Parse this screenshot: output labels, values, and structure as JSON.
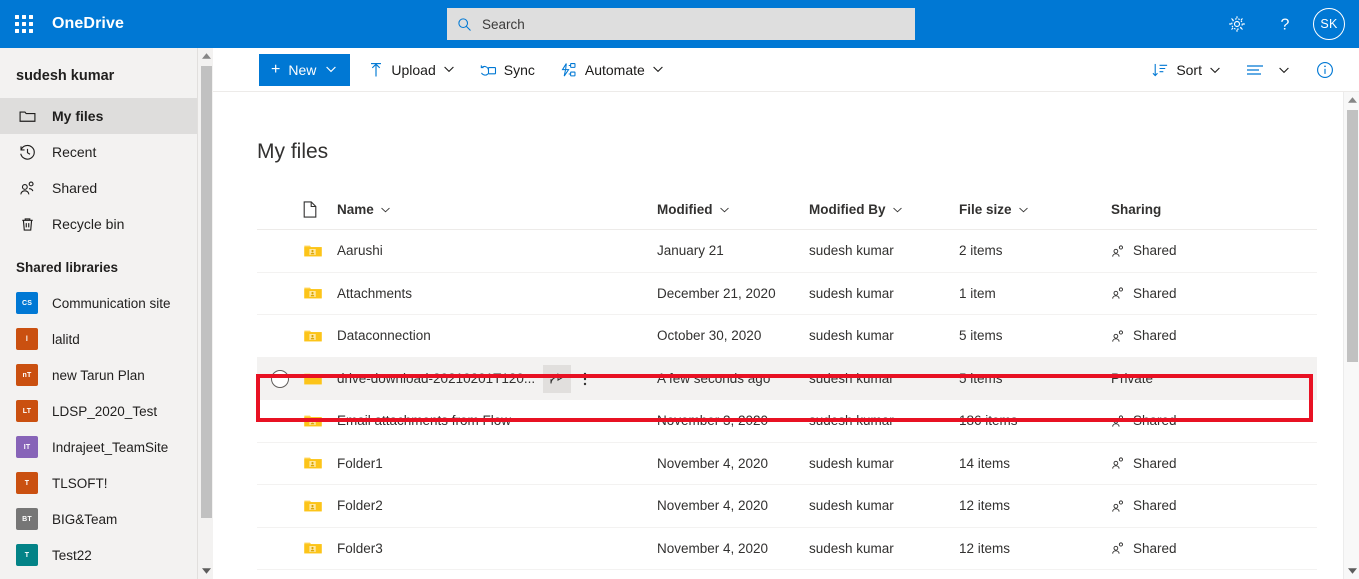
{
  "suitebar": {
    "waffle_label": "App launcher",
    "brand": "OneDrive",
    "search": {
      "placeholder": "Search",
      "value": ""
    },
    "settings_label": "Settings",
    "help_label": "Help",
    "avatar_initials": "SK",
    "bg_color": "#0078d4"
  },
  "sidebar": {
    "user": "sudesh kumar",
    "items": [
      {
        "label": "My files",
        "icon": "folder-icon",
        "selected": true
      },
      {
        "label": "Recent",
        "icon": "clock-icon",
        "selected": false
      },
      {
        "label": "Shared",
        "icon": "people-icon",
        "selected": false
      },
      {
        "label": "Recycle bin",
        "icon": "trash-icon",
        "selected": false
      }
    ],
    "section_title": "Shared libraries",
    "libraries": [
      {
        "label": "Communication site",
        "initials": "CS",
        "color": "#0078d4"
      },
      {
        "label": "lalitd",
        "initials": "l",
        "color": "#ca5010"
      },
      {
        "label": "new Tarun Plan",
        "initials": "nT",
        "color": "#ca5010"
      },
      {
        "label": "LDSP_2020_Test",
        "initials": "LT",
        "color": "#ca5010"
      },
      {
        "label": "Indrajeet_TeamSite",
        "initials": "IT",
        "color": "#8764b8"
      },
      {
        "label": "TLSOFT!",
        "initials": "T",
        "color": "#ca5010"
      },
      {
        "label": "BIG&Team",
        "initials": "BT",
        "color": "#767676"
      },
      {
        "label": "Test22",
        "initials": "T",
        "color": "#038387"
      }
    ]
  },
  "commandbar": {
    "new_label": "New",
    "upload_label": "Upload",
    "sync_label": "Sync",
    "automate_label": "Automate",
    "sort_label": "Sort",
    "view_label": "View options",
    "info_label": "Details",
    "accent_color": "#0078d4"
  },
  "content": {
    "title": "My files",
    "columns": {
      "icon": "file-type-icon",
      "name": "Name",
      "modified": "Modified",
      "modified_by": "Modified By",
      "file_size": "File size",
      "sharing": "Sharing"
    },
    "rows": [
      {
        "name": "Aarushi",
        "modified": "January 21",
        "modified_by": "sudesh kumar",
        "file_size": "2 items",
        "sharing": "Shared",
        "shared": true,
        "icon": "shared-folder-icon",
        "highlighted": false
      },
      {
        "name": "Attachments",
        "modified": "December 21, 2020",
        "modified_by": "sudesh kumar",
        "file_size": "1 item",
        "sharing": "Shared",
        "shared": true,
        "icon": "shared-folder-icon",
        "highlighted": false
      },
      {
        "name": "Dataconnection",
        "modified": "October 30, 2020",
        "modified_by": "sudesh kumar",
        "file_size": "5 items",
        "sharing": "Shared",
        "shared": true,
        "icon": "shared-folder-icon",
        "highlighted": false
      },
      {
        "name": "drive-download-20210201T120...",
        "modified": "A few seconds ago",
        "modified_by": "sudesh kumar",
        "file_size": "5 items",
        "sharing": "Private",
        "shared": false,
        "icon": "folder-icon",
        "highlighted": true
      },
      {
        "name": "Email attachments from Flow",
        "modified": "November 3, 2020",
        "modified_by": "sudesh kumar",
        "file_size": "186 items",
        "sharing": "Shared",
        "shared": true,
        "icon": "shared-folder-icon",
        "highlighted": false
      },
      {
        "name": "Folder1",
        "modified": "November 4, 2020",
        "modified_by": "sudesh kumar",
        "file_size": "14 items",
        "sharing": "Shared",
        "shared": true,
        "icon": "shared-folder-icon",
        "highlighted": false
      },
      {
        "name": "Folder2",
        "modified": "November 4, 2020",
        "modified_by": "sudesh kumar",
        "file_size": "12 items",
        "sharing": "Shared",
        "shared": true,
        "icon": "shared-folder-icon",
        "highlighted": false
      },
      {
        "name": "Folder3",
        "modified": "November 4, 2020",
        "modified_by": "sudesh kumar",
        "file_size": "12 items",
        "sharing": "Shared",
        "shared": true,
        "icon": "shared-folder-icon",
        "highlighted": false
      }
    ],
    "row_actions": {
      "share": "share-icon",
      "more": "more-options-icon"
    },
    "highlight_color": "#e81123"
  }
}
